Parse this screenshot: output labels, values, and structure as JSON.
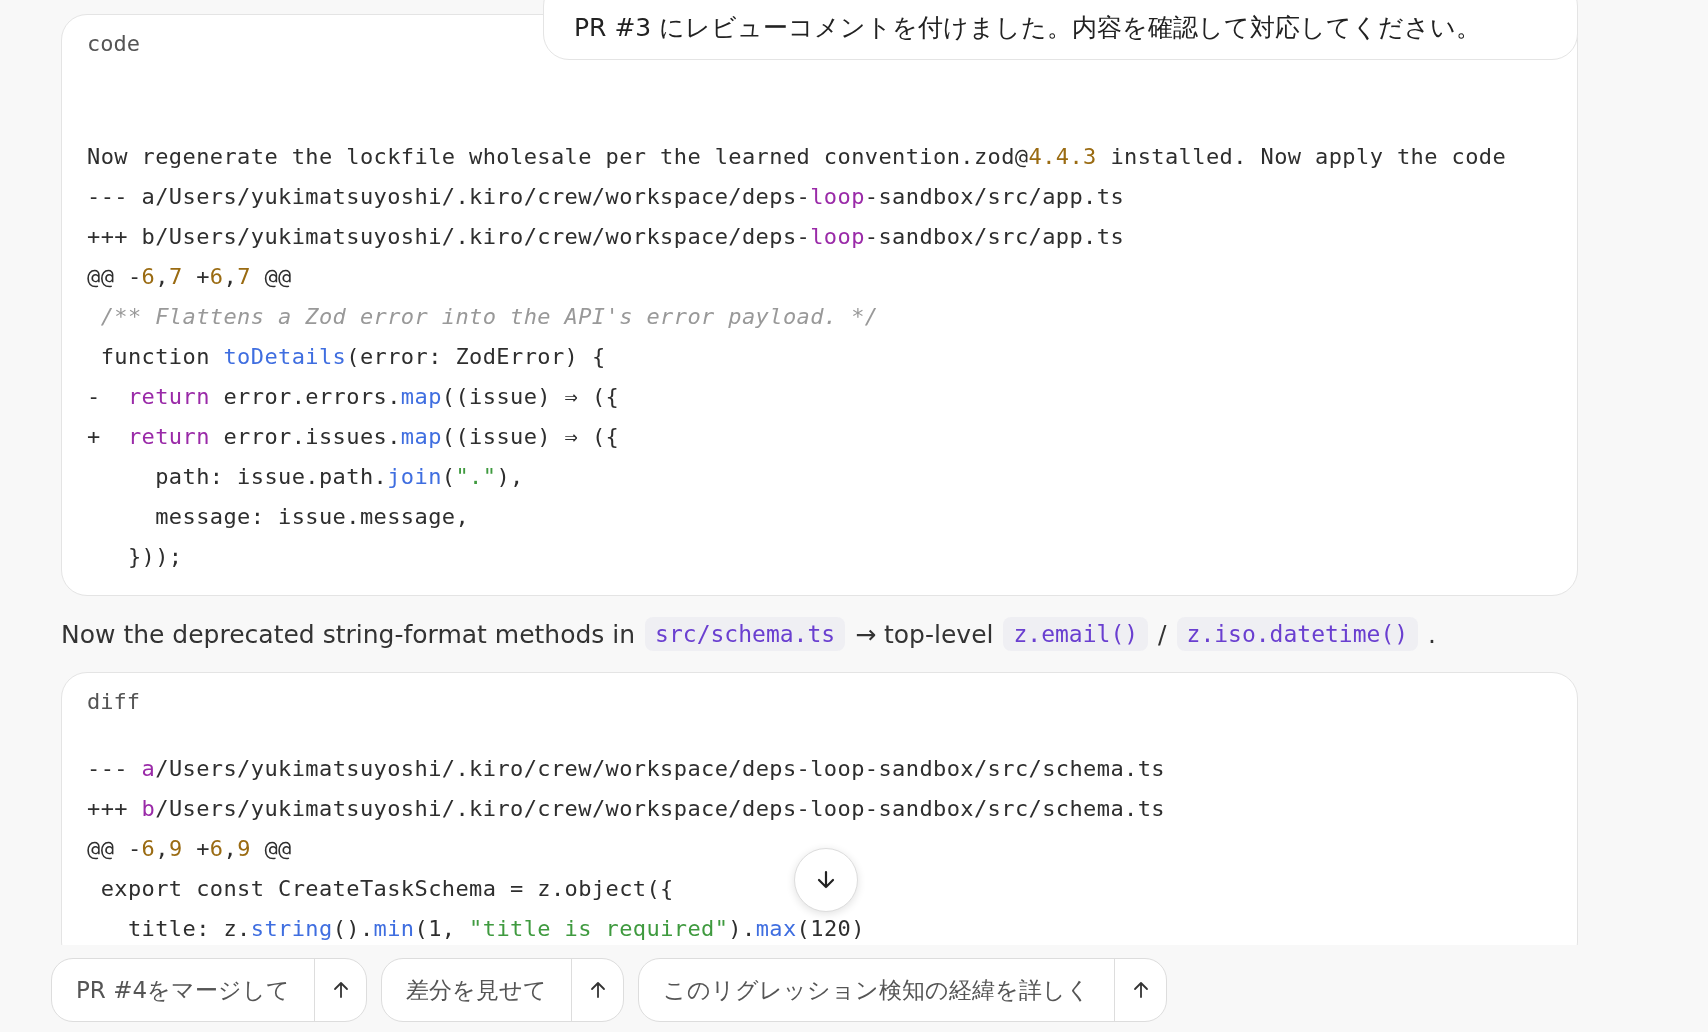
{
  "user_message": {
    "text": "PR #3 にレビューコメントを付けました。内容を確認して対応してください。"
  },
  "blocks": [
    {
      "kind": "code",
      "label": "code",
      "lines": [
        [
          {
            "t": "Now regenerate the lockfile wholesale per the learned convention.zod@",
            "kind": "plain"
          },
          {
            "t": "4.4.3",
            "kind": "number"
          },
          {
            "t": " installed. Now apply the code",
            "kind": "plain"
          }
        ],
        [
          {
            "t": "--- a/Users/yukimatsuyoshi/.kiro/crew/workspace/deps-",
            "kind": "plain"
          },
          {
            "t": "loop",
            "kind": "keyword"
          },
          {
            "t": "-sandbox/src/app.ts",
            "kind": "plain"
          }
        ],
        [
          {
            "t": "+++ b/Users/yukimatsuyoshi/.kiro/crew/workspace/deps-",
            "kind": "plain"
          },
          {
            "t": "loop",
            "kind": "keyword"
          },
          {
            "t": "-sandbox/src/app.ts",
            "kind": "plain"
          }
        ],
        [
          {
            "t": "@@ -",
            "kind": "plain"
          },
          {
            "t": "6",
            "kind": "number"
          },
          {
            "t": ",",
            "kind": "plain"
          },
          {
            "t": "7",
            "kind": "number"
          },
          {
            "t": " +",
            "kind": "plain"
          },
          {
            "t": "6",
            "kind": "number"
          },
          {
            "t": ",",
            "kind": "plain"
          },
          {
            "t": "7",
            "kind": "number"
          },
          {
            "t": " @@",
            "kind": "plain"
          }
        ],
        [
          {
            "t": " /** Flattens a Zod error into the API's error payload. */",
            "kind": "comment"
          }
        ],
        [
          {
            "t": " function ",
            "kind": "plain"
          },
          {
            "t": "toDetails",
            "kind": "func"
          },
          {
            "t": "(error: ZodError) {",
            "kind": "plain"
          }
        ],
        [
          {
            "t": "-  ",
            "kind": "plain"
          },
          {
            "t": "return",
            "kind": "keyword"
          },
          {
            "t": " error.errors.",
            "kind": "plain"
          },
          {
            "t": "map",
            "kind": "func"
          },
          {
            "t": "((issue) ⇒ ({",
            "kind": "plain"
          }
        ],
        [
          {
            "t": "+  ",
            "kind": "plain"
          },
          {
            "t": "return",
            "kind": "keyword"
          },
          {
            "t": " error.issues.",
            "kind": "plain"
          },
          {
            "t": "map",
            "kind": "func"
          },
          {
            "t": "((issue) ⇒ ({",
            "kind": "plain"
          }
        ],
        [
          {
            "t": "     path: issue.path.",
            "kind": "plain"
          },
          {
            "t": "join",
            "kind": "func"
          },
          {
            "t": "(",
            "kind": "plain"
          },
          {
            "t": "\".\"",
            "kind": "string"
          },
          {
            "t": "),",
            "kind": "plain"
          }
        ],
        [
          {
            "t": "     message: issue.message,",
            "kind": "plain"
          }
        ],
        [
          {
            "t": "   }));",
            "kind": "plain"
          }
        ]
      ]
    },
    {
      "kind": "sentence",
      "segments": [
        {
          "t": "Now the deprecated string-format methods in",
          "kind": "text"
        },
        {
          "t": "src/schema.ts",
          "kind": "code"
        },
        {
          "t": "→ top-level",
          "kind": "text"
        },
        {
          "t": "z.email()",
          "kind": "code"
        },
        {
          "t": "/",
          "kind": "text"
        },
        {
          "t": "z.iso.datetime()",
          "kind": "code"
        },
        {
          "t": ".",
          "kind": "text"
        }
      ]
    },
    {
      "kind": "code",
      "label": "diff",
      "lines": [
        [
          {
            "t": "--- ",
            "kind": "plain"
          },
          {
            "t": "a",
            "kind": "keyword"
          },
          {
            "t": "/Users/yukimatsuyoshi/.kiro/crew/workspace/deps-loop-sandbox/src/schema.ts",
            "kind": "plain"
          }
        ],
        [
          {
            "t": "+++ ",
            "kind": "plain"
          },
          {
            "t": "b",
            "kind": "keyword"
          },
          {
            "t": "/Users/yukimatsuyoshi/.kiro/crew/workspace/deps-loop-sandbox/src/schema.ts",
            "kind": "plain"
          }
        ],
        [
          {
            "t": "@@ -",
            "kind": "plain"
          },
          {
            "t": "6",
            "kind": "number"
          },
          {
            "t": ",",
            "kind": "plain"
          },
          {
            "t": "9",
            "kind": "number"
          },
          {
            "t": " +",
            "kind": "plain"
          },
          {
            "t": "6",
            "kind": "number"
          },
          {
            "t": ",",
            "kind": "plain"
          },
          {
            "t": "9",
            "kind": "number"
          },
          {
            "t": " @@",
            "kind": "plain"
          }
        ],
        [
          {
            "t": " export const CreateTaskSchema = z.object({",
            "kind": "plain"
          }
        ],
        [
          {
            "t": "   title: z.",
            "kind": "plain"
          },
          {
            "t": "string",
            "kind": "func"
          },
          {
            "t": "().",
            "kind": "plain"
          },
          {
            "t": "min",
            "kind": "func"
          },
          {
            "t": "(1, ",
            "kind": "plain"
          },
          {
            "t": "\"title is required\"",
            "kind": "string"
          },
          {
            "t": ").",
            "kind": "plain"
          },
          {
            "t": "max",
            "kind": "func"
          },
          {
            "t": "(120)",
            "kind": "plain"
          }
        ]
      ]
    }
  ],
  "suggestions": [
    {
      "label": "PR #4をマージして"
    },
    {
      "label": "差分を見せて"
    },
    {
      "label": "このリグレッション検知の経緯を詳しく"
    }
  ]
}
